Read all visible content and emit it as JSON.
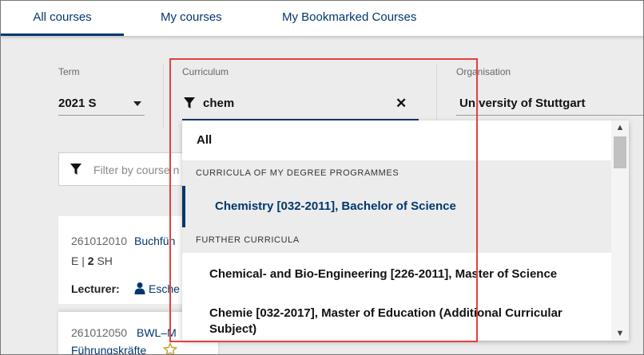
{
  "tabs": [
    {
      "label": "All courses",
      "active": true
    },
    {
      "label": "My courses",
      "active": false
    },
    {
      "label": "My Bookmarked Courses",
      "active": false
    }
  ],
  "filters": {
    "term": {
      "label": "Term",
      "value": "2021 S"
    },
    "curriculum": {
      "label": "Curriculum",
      "value": "chem",
      "clear_icon": "close-icon"
    },
    "organisation": {
      "label": "Organisation",
      "value": "University of Stuttgart"
    }
  },
  "course_filter": {
    "placeholder": "Filter by course n"
  },
  "courses": [
    {
      "number": "261012010",
      "title": "Buchfüh",
      "type": "E",
      "sh": "2",
      "sh_unit": "SH",
      "lecturer_label": "Lecturer:",
      "lecturer": "Esche"
    },
    {
      "number": "261012050",
      "title": "BWL–M",
      "title_line2": "Führungskräfte"
    }
  ],
  "dropdown": {
    "all": "All",
    "group1": "CURRICULA OF MY DEGREE PROGRAMMES",
    "group1_items": [
      "Chemistry [032-2011], Bachelor of Science"
    ],
    "group2": "FURTHER CURRICULA",
    "group2_items": [
      "Chemical- and Bio-Engineering [226-2011], Master of Science",
      "Chemie [032-2017], Master of Education (Additional Curricular Subject)"
    ]
  },
  "colors": {
    "accent": "#00376e",
    "highlight": "#e3403f",
    "background": "#ececec"
  }
}
